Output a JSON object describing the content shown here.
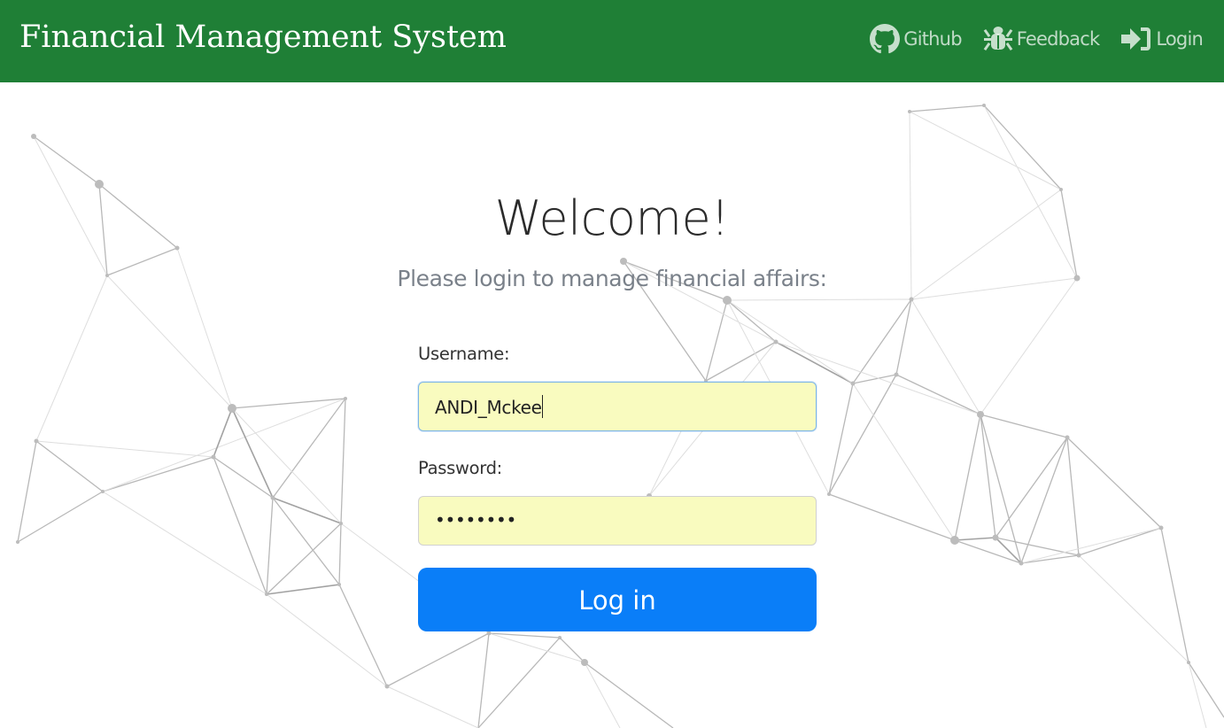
{
  "navbar": {
    "brand": "Financial Management System",
    "links": [
      {
        "label": "Github",
        "icon": "github-icon"
      },
      {
        "label": "Feedback",
        "icon": "bug-icon"
      },
      {
        "label": "Login",
        "icon": "sign-in-icon"
      }
    ],
    "background_color": "#1f7f36"
  },
  "main": {
    "title": "Welcome!",
    "subtitle": "Please login to manage financial affairs:",
    "form": {
      "username_label": "Username:",
      "username_value": "ANDI_Mckee",
      "password_label": "Password:",
      "password_masked": "••••••••",
      "submit_label": "Log in"
    },
    "button_color": "#0a7ef8",
    "input_background": "#f9fbbf"
  },
  "background": {
    "decoration": "network-lines-icon"
  }
}
